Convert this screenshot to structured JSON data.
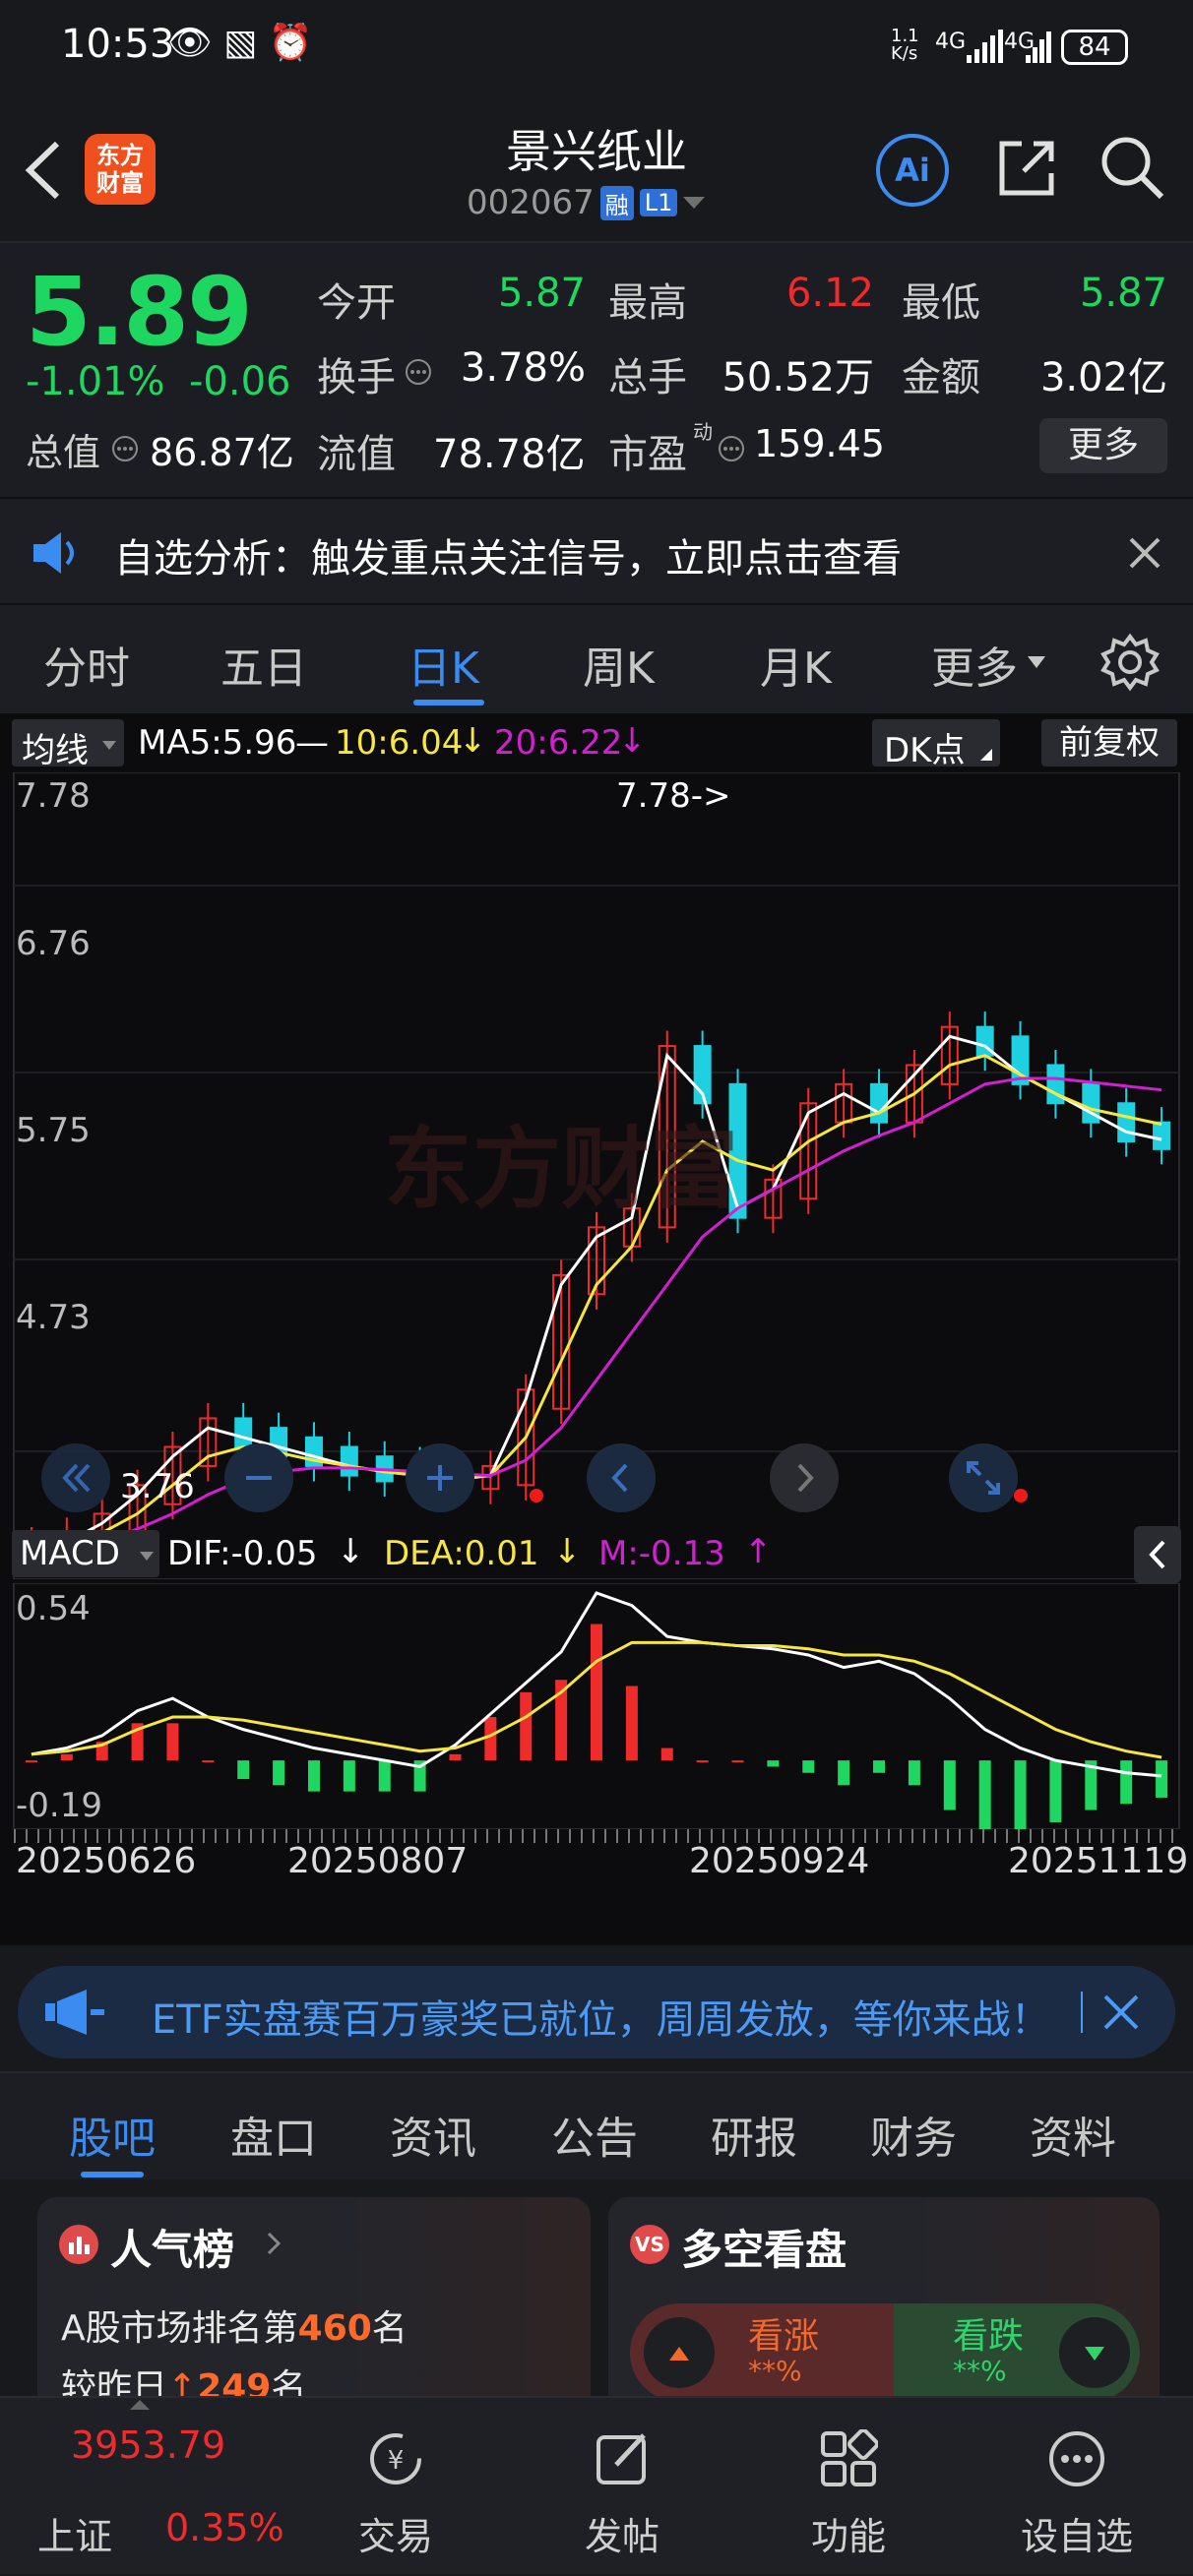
{
  "status": {
    "time": "10:53",
    "net_speed": "1.1 K/s",
    "signal1": "4G",
    "signal2": "4G",
    "battery": "84"
  },
  "header": {
    "title": "景兴纸业",
    "code": "002067",
    "badge_rong": "融",
    "badge_level": "L1",
    "logo_text_1": "东方",
    "logo_text_2": "财富",
    "ai_label": "Ai"
  },
  "quote": {
    "price": "5.89",
    "change_pct": "-1.01%",
    "change": "-0.06",
    "open_label": "今开",
    "open": "5.87",
    "high_label": "最高",
    "high": "6.12",
    "low_label": "最低",
    "low": "5.87",
    "turnover_label": "换手",
    "turnover": "3.78%",
    "volume_label": "总手",
    "volume": "50.52万",
    "amount_label": "金额",
    "amount": "3.02亿",
    "mktcap_label": "总值",
    "mktcap": "86.87亿",
    "float_label": "流值",
    "float": "78.78亿",
    "pe_label": "市盈",
    "pe_sup": "动",
    "pe": "159.45",
    "more_button": "更多"
  },
  "notice": {
    "text": "自选分析：触发重点关注信号，立即点击查看"
  },
  "chart_tabs": [
    "分时",
    "五日",
    "日K",
    "周K",
    "月K",
    "更多"
  ],
  "active_chart_tab": "日K",
  "kline": {
    "indicator": "均线",
    "ma5": "MA5:5.96",
    "ma10": "10:6.04",
    "ma20": "20:6.22",
    "dk_button": "DK点",
    "adjust_button": "前复权",
    "y_labels": [
      "7.78",
      "6.76",
      "5.75",
      "4.73"
    ],
    "max_annotation": "7.78->",
    "min_annotation": "3.76",
    "watermark": "东方财富"
  },
  "macd": {
    "indicator": "MACD",
    "dif": "DIF:-0.05",
    "dea": "DEA:0.01",
    "m": "M:-0.13",
    "y_top": "0.54",
    "y_bottom": "-0.19"
  },
  "dates": [
    "20250626",
    "20250807",
    "20250924",
    "20251119"
  ],
  "chart_data": {
    "type": "line",
    "y_range": [
      3.76,
      7.78
    ],
    "series": [
      {
        "name": "MA5",
        "values": [
          3.8,
          3.85,
          3.95,
          4.1,
          4.3,
          4.45,
          4.4,
          4.35,
          4.3,
          4.25,
          4.22,
          4.2,
          4.18,
          4.2,
          4.6,
          5.2,
          5.45,
          5.55,
          6.4,
          6.2,
          5.6,
          5.7,
          6.1,
          6.2,
          6.1,
          6.3,
          6.5,
          6.45,
          6.3,
          6.2,
          6.1,
          6.0,
          5.96
        ]
      },
      {
        "name": "10",
        "values": [
          3.8,
          3.82,
          3.9,
          4.0,
          4.15,
          4.3,
          4.35,
          4.32,
          4.28,
          4.25,
          4.22,
          4.2,
          4.19,
          4.2,
          4.4,
          4.8,
          5.2,
          5.4,
          5.8,
          5.95,
          5.85,
          5.8,
          5.95,
          6.05,
          6.1,
          6.2,
          6.35,
          6.4,
          6.3,
          6.2,
          6.12,
          6.08,
          6.04
        ]
      },
      {
        "name": "20",
        "values": [
          3.8,
          3.81,
          3.85,
          3.92,
          4.0,
          4.1,
          4.18,
          4.22,
          4.24,
          4.24,
          4.23,
          4.22,
          4.21,
          4.2,
          4.28,
          4.45,
          4.7,
          4.95,
          5.2,
          5.45,
          5.6,
          5.7,
          5.8,
          5.9,
          5.98,
          6.05,
          6.15,
          6.25,
          6.28,
          6.28,
          6.26,
          6.24,
          6.22
        ]
      }
    ],
    "macd_range": [
      -0.19,
      0.54
    ],
    "macd_dif": [
      0.02,
      0.04,
      0.08,
      0.16,
      0.2,
      0.14,
      0.1,
      0.07,
      0.04,
      0.02,
      0.0,
      -0.02,
      0.05,
      0.15,
      0.25,
      0.35,
      0.54,
      0.5,
      0.4,
      0.38,
      0.37,
      0.36,
      0.34,
      0.3,
      0.32,
      0.28,
      0.2,
      0.1,
      0.04,
      0.0,
      -0.02,
      -0.04,
      -0.05
    ],
    "macd_dea": [
      0.02,
      0.03,
      0.05,
      0.1,
      0.14,
      0.14,
      0.13,
      0.11,
      0.09,
      0.07,
      0.05,
      0.03,
      0.04,
      0.08,
      0.14,
      0.22,
      0.32,
      0.38,
      0.38,
      0.38,
      0.37,
      0.37,
      0.36,
      0.34,
      0.34,
      0.32,
      0.28,
      0.22,
      0.16,
      0.1,
      0.06,
      0.03,
      0.01
    ]
  },
  "banner": {
    "text": "ETF实盘赛百万豪奖已就位，周周发放，等你来战！"
  },
  "lower_tabs": [
    "股吧",
    "盘口",
    "资讯",
    "公告",
    "研报",
    "财务",
    "资料"
  ],
  "active_lower_tab": "股吧",
  "popularity": {
    "title": "人气榜",
    "rank_prefix": "A股市场排名第",
    "rank": "460",
    "rank_suffix": "名",
    "change_prefix": "较昨日",
    "change": "249",
    "change_suffix": "名"
  },
  "bullbear": {
    "title": "多空看盘",
    "bull_label": "看涨",
    "bull_pct": "**%",
    "bear_label": "看跌",
    "bear_pct": "**%"
  },
  "bottom_nav": {
    "index_value": "3953.79",
    "index_name": "上证",
    "index_change": "0.35%",
    "trade": "交易",
    "post": "发帖",
    "func": "功能",
    "watchlist": "设自选"
  },
  "colors": {
    "up": "#f02b2b",
    "down": "#1ed760",
    "ma5": "#ffffff",
    "ma10": "#f5e642",
    "ma20": "#d21fd2",
    "accent": "#3a8cf0"
  }
}
